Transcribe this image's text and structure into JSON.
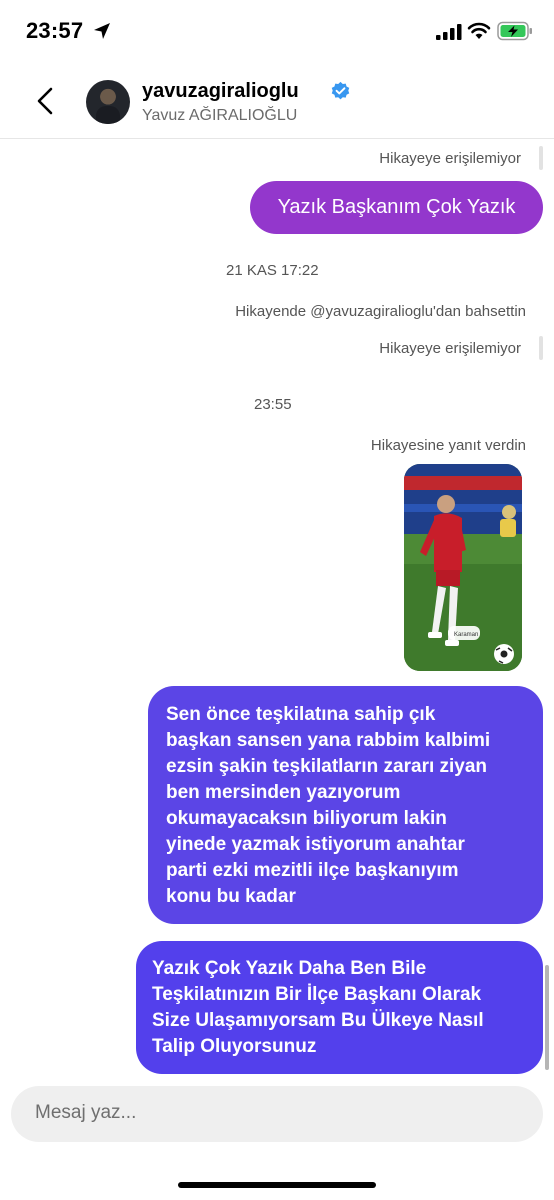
{
  "status_bar": {
    "time": "23:57"
  },
  "header": {
    "username": "yavuzagiralioglu",
    "full_name": "Yavuz AĞIRALIOĞLU"
  },
  "messages": {
    "story_unavailable_1": "Hikayeye erişilemiyor",
    "bubble_1": "Yazık Başkanım Çok Yazık",
    "timestamp_1": "21 KAS 17:22",
    "mention_note": "Hikayende @yavuzagiralioglu'dan bahsettin",
    "story_unavailable_2": "Hikayeye erişilemiyor",
    "timestamp_2": "23:55",
    "reply_note": "Hikayesine yanıt verdin",
    "photo_tag": "Karaman",
    "bubble_2_lines": [
      "Sen önce teşkilatına sahip çık",
      "başkan sansen yana rabbim kalbimi",
      "ezsin şakin teşkilatların zararı ziyan",
      "ben mersinden yazıyorum",
      "okumayacaksın biliyorum lakin",
      "yinede yazmak istiyorum anahtar",
      "parti ezki mezitli ilçe başkanıyım",
      "konu bu kadar"
    ],
    "bubble_3_lines": [
      "Yazık Çok Yazık Daha Ben Bile",
      "Teşkilatınızın Bir İlçe Başkanı Olarak",
      "Size Ulaşamıyorsam  Bu Ülkeye Nasıl",
      "Talip Oluyorsunuz"
    ]
  },
  "composer": {
    "placeholder": "Mesaj yaz..."
  },
  "colors": {
    "bubble_purple": "#9337cc",
    "bubble_indigo": "#5b45e6",
    "verified_blue": "#3897f0",
    "battery_green": "#34c759"
  }
}
